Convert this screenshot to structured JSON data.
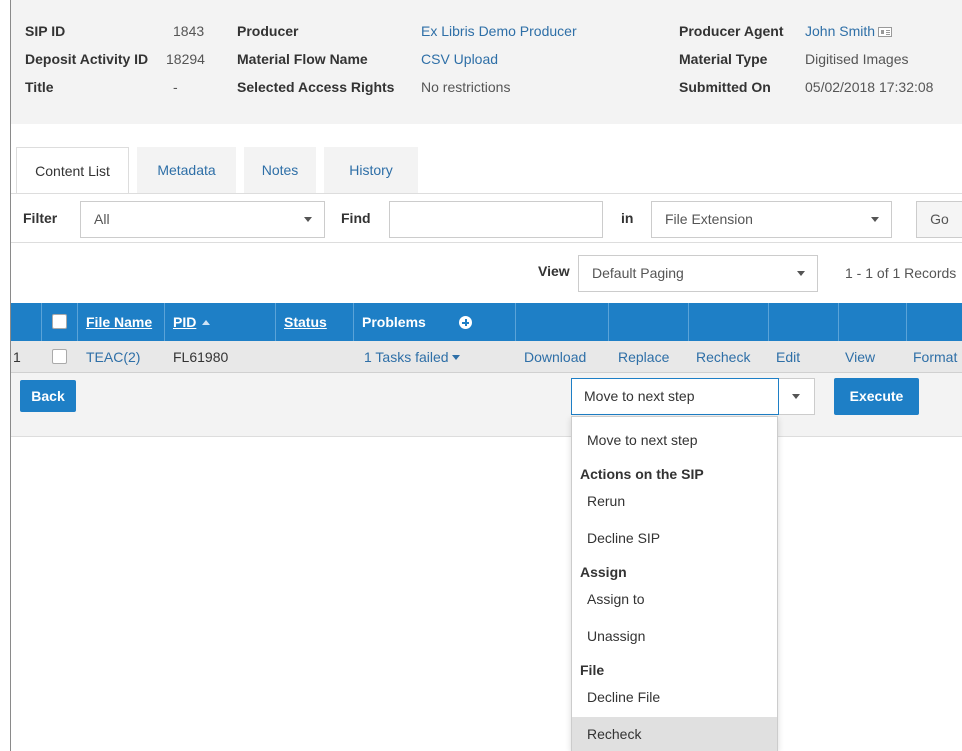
{
  "header": {
    "sip_id_label": "SIP ID",
    "sip_id": "1843",
    "deposit_label": "Deposit Activity ID",
    "deposit_id": "18294",
    "title_label": "Title",
    "title": "-",
    "producer_label": "Producer",
    "producer": "Ex Libris Demo Producer",
    "material_flow_label": "Material Flow Name",
    "material_flow": "CSV Upload",
    "access_rights_label": "Selected Access Rights",
    "access_rights": "No restrictions",
    "producer_agent_label": "Producer Agent",
    "producer_agent": "John Smith",
    "material_type_label": "Material Type",
    "material_type": "Digitised Images",
    "submitted_label": "Submitted On",
    "submitted_on": "05/02/2018 17:32:08"
  },
  "tabs": [
    "Content List",
    "Metadata",
    "Notes",
    "History"
  ],
  "filter": {
    "filter_label": "Filter",
    "filter_value": "All",
    "find_label": "Find",
    "find_value": "",
    "in_label": "in",
    "in_value": "File Extension",
    "go_label": "Go"
  },
  "view": {
    "label": "View",
    "value": "Default Paging",
    "records": "1 - 1 of 1 Records"
  },
  "table": {
    "headers": {
      "file_name": "File Name",
      "pid": "PID",
      "status": "Status",
      "problems": "Problems"
    },
    "row": {
      "num": "1",
      "file_name": "TEAC(2)",
      "pid": "FL61980",
      "status": "",
      "problems": "1 Tasks failed",
      "download": "Download",
      "replace": "Replace",
      "recheck": "Recheck",
      "edit": "Edit",
      "view": "View",
      "format": "Format"
    }
  },
  "actions": {
    "back": "Back",
    "selected": "Move to next step",
    "execute": "Execute"
  },
  "dropdown": {
    "item_move": "Move to next step",
    "group_sip": "Actions on the SIP",
    "item_rerun": "Rerun",
    "item_decline_sip": "Decline SIP",
    "group_assign": "Assign",
    "item_assign_to": "Assign to",
    "item_unassign": "Unassign",
    "group_file": "File",
    "item_decline_file": "Decline File",
    "item_recheck": "Recheck"
  },
  "colors": {
    "accent": "#1e7fc6",
    "link": "#2e6fa7",
    "header_bg": "#f3f3f3"
  }
}
